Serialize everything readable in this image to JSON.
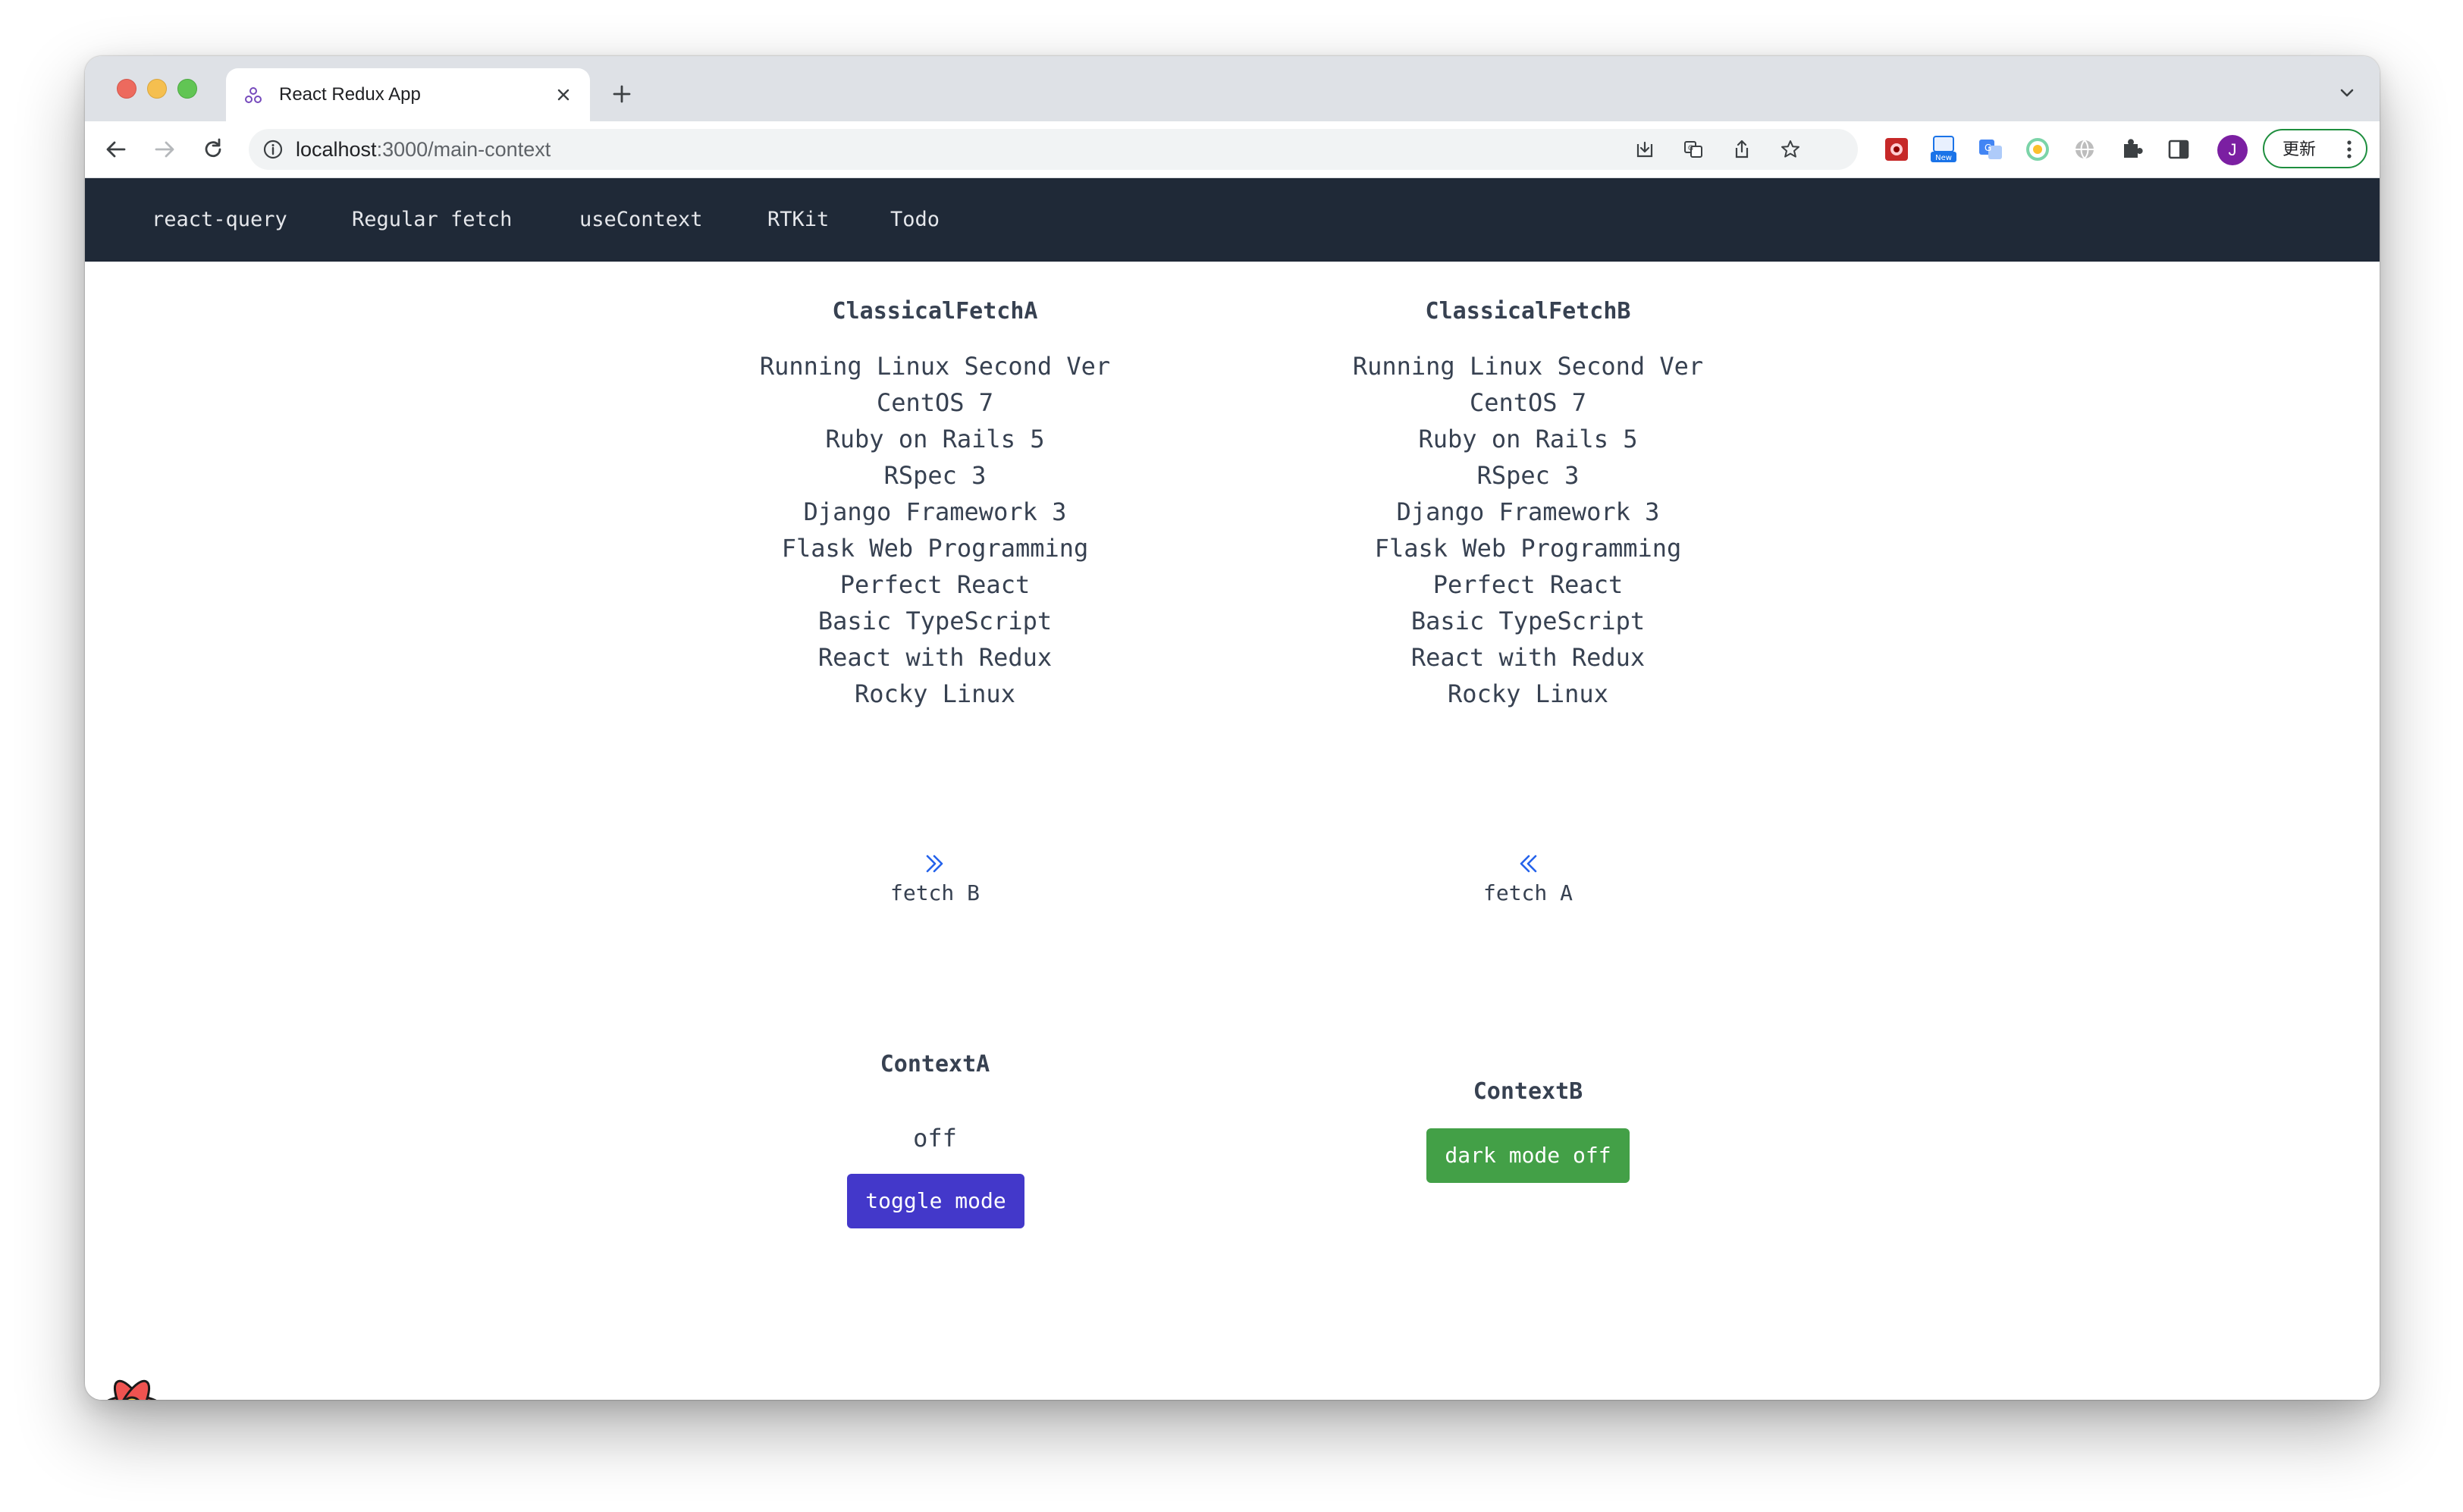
{
  "browser": {
    "tab": {
      "title": "React Redux App"
    },
    "address_bar": {
      "host": "localhost",
      "path": ":3000/main-context"
    },
    "update_button": {
      "label": "更新"
    },
    "profile": {
      "initial": "J"
    },
    "extensions": [
      "red-extension",
      "new-badge-extension",
      "translate-extension",
      "green-circle-extension",
      "gray-globe-extension",
      "puzzle-extensions"
    ],
    "extension_badge": "New"
  },
  "navbar": {
    "links": [
      {
        "label": "react-query"
      },
      {
        "label": "Regular fetch"
      },
      {
        "label": "useContext"
      },
      {
        "label": "RTKit"
      },
      {
        "label": "Todo"
      }
    ]
  },
  "fetch_a": {
    "title": "ClassicalFetchA",
    "books": [
      "Running Linux Second Ver",
      "CentOS 7",
      "Ruby on Rails 5",
      "RSpec 3",
      "Django Framework 3",
      "Flask Web Programming",
      "Perfect React",
      "Basic TypeScript",
      "React with Redux",
      "Rocky Linux"
    ],
    "link_label": "fetch B",
    "icon": "chevrons-right-icon"
  },
  "fetch_b": {
    "title": "ClassicalFetchB",
    "books": [
      "Running Linux Second Ver",
      "CentOS 7",
      "Ruby on Rails 5",
      "RSpec 3",
      "Django Framework 3",
      "Flask Web Programming",
      "Perfect React",
      "Basic TypeScript",
      "React with Redux",
      "Rocky Linux"
    ],
    "link_label": "fetch A",
    "icon": "chevrons-left-icon"
  },
  "context_a": {
    "title": "ContextA",
    "status": "off",
    "button_label": "toggle mode"
  },
  "context_b": {
    "title": "ContextB",
    "button_label": "dark mode off"
  },
  "colors": {
    "navbar_bg": "#1f2937",
    "toggle_button": "#4338ca",
    "dark_mode_button": "#43a047",
    "chevron": "#2563eb"
  }
}
